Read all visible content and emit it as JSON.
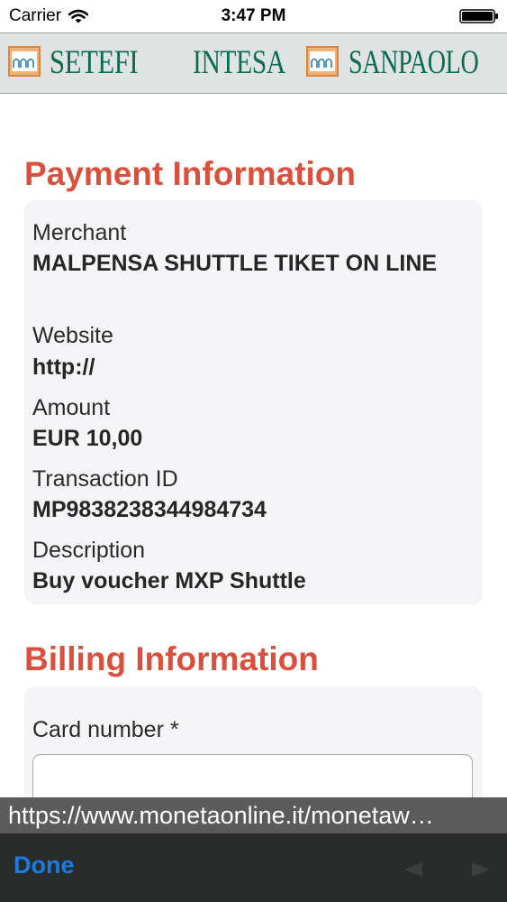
{
  "status_bar": {
    "carrier": "Carrier",
    "time": "3:47 PM"
  },
  "banner": {
    "logo_left": "SETEFI",
    "logo_center": "INTESA",
    "logo_right": "SANPAOLO"
  },
  "payment": {
    "title": "Payment Information",
    "fields": [
      {
        "label": "Merchant",
        "value": "MALPENSA SHUTTLE TIKET ON LINE"
      },
      {
        "label": "Website",
        "value": "http://"
      },
      {
        "label": "Amount",
        "value": "EUR 10,00"
      },
      {
        "label": "Transaction ID",
        "value": "MP9838238344984734"
      },
      {
        "label": "Description",
        "value": "Buy voucher MXP Shuttle"
      }
    ]
  },
  "billing": {
    "title": "Billing Information",
    "card_number_label": "Card number *",
    "card_number_value": ""
  },
  "url_bar": {
    "url": "https://www.monetaonline.it/monetaw…"
  },
  "toolbar": {
    "done_label": "Done"
  },
  "icons": {
    "wifi": "wifi-icon",
    "battery": "battery-icon",
    "logo_mark": "arches-logo-icon",
    "back": "back-arrow-icon",
    "forward": "forward-arrow-icon"
  },
  "colors": {
    "section_title": "#d9513c",
    "logo_text": "#0d6b53",
    "logo_mark": "#e0823a",
    "done_button": "#1a7be3",
    "toolbar_bg": "#2a2b2b",
    "url_bar_bg": "#5b5b5b",
    "panel_bg": "#f5f5f7"
  }
}
